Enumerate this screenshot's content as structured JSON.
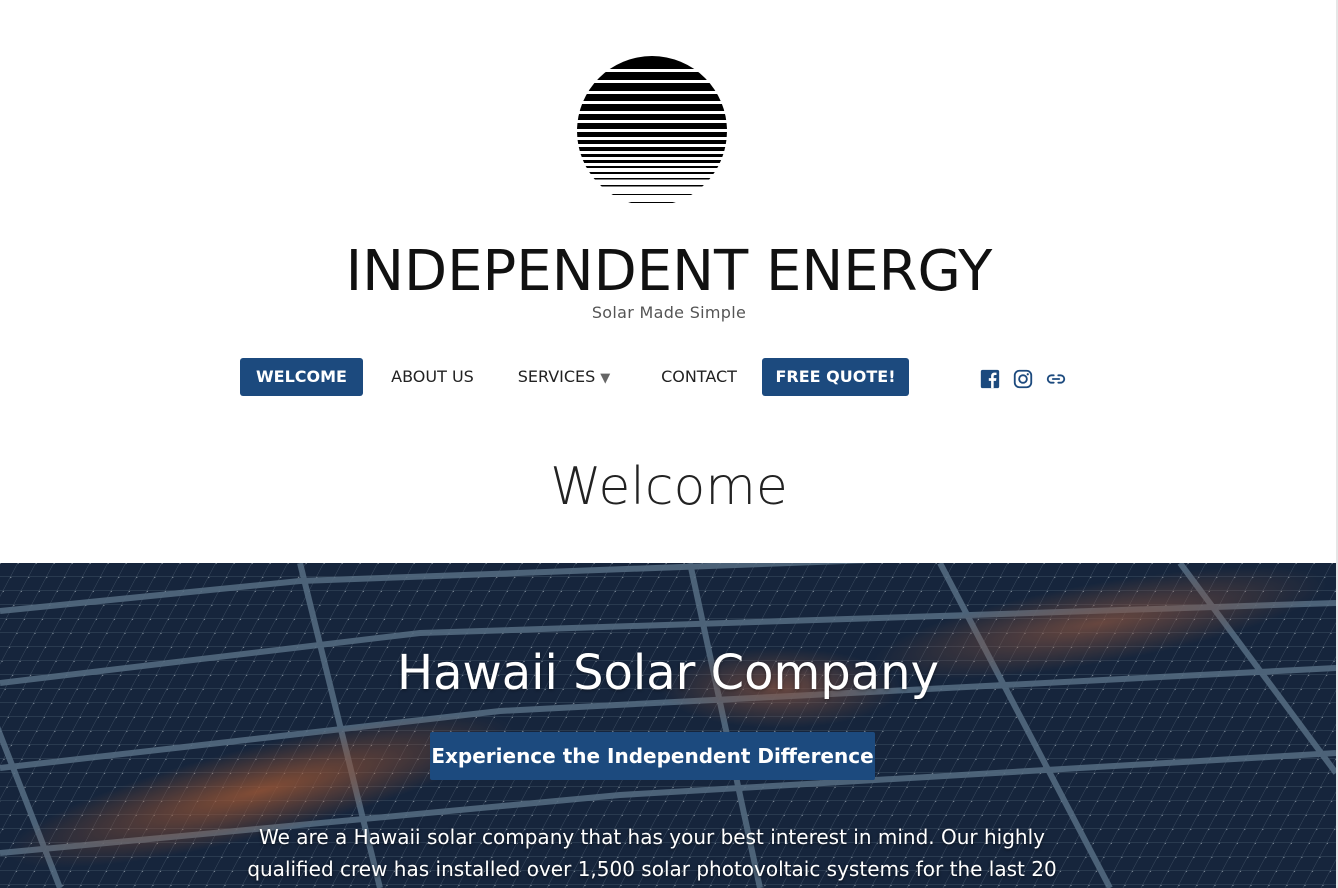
{
  "site": {
    "title": "INDEPENDENT ENERGY",
    "tagline": "Solar Made Simple",
    "logo_icon": "striped-sun-logo"
  },
  "nav": {
    "items": [
      {
        "label": "WELCOME",
        "active": true
      },
      {
        "label": "ABOUT US"
      },
      {
        "label": "SERVICES",
        "has_dropdown": true,
        "caret": "▼"
      },
      {
        "label": "CONTACT"
      },
      {
        "label": "FREE QUOTE!",
        "highlight": true
      }
    ],
    "social": [
      "facebook-icon",
      "instagram-icon",
      "link-icon"
    ]
  },
  "page": {
    "heading": "Welcome"
  },
  "hero": {
    "title": "Hawaii Solar Company",
    "button_label": "Experience the Independent Difference",
    "text": "We are a Hawaii solar company that has your best interest in mind. Our highly qualified crew has installed over 1,500 solar photovoltaic systems for the last 20"
  },
  "colors": {
    "accent": "#1c4a7e",
    "title": "#111111",
    "text": "#222222",
    "tagline": "#555555"
  }
}
